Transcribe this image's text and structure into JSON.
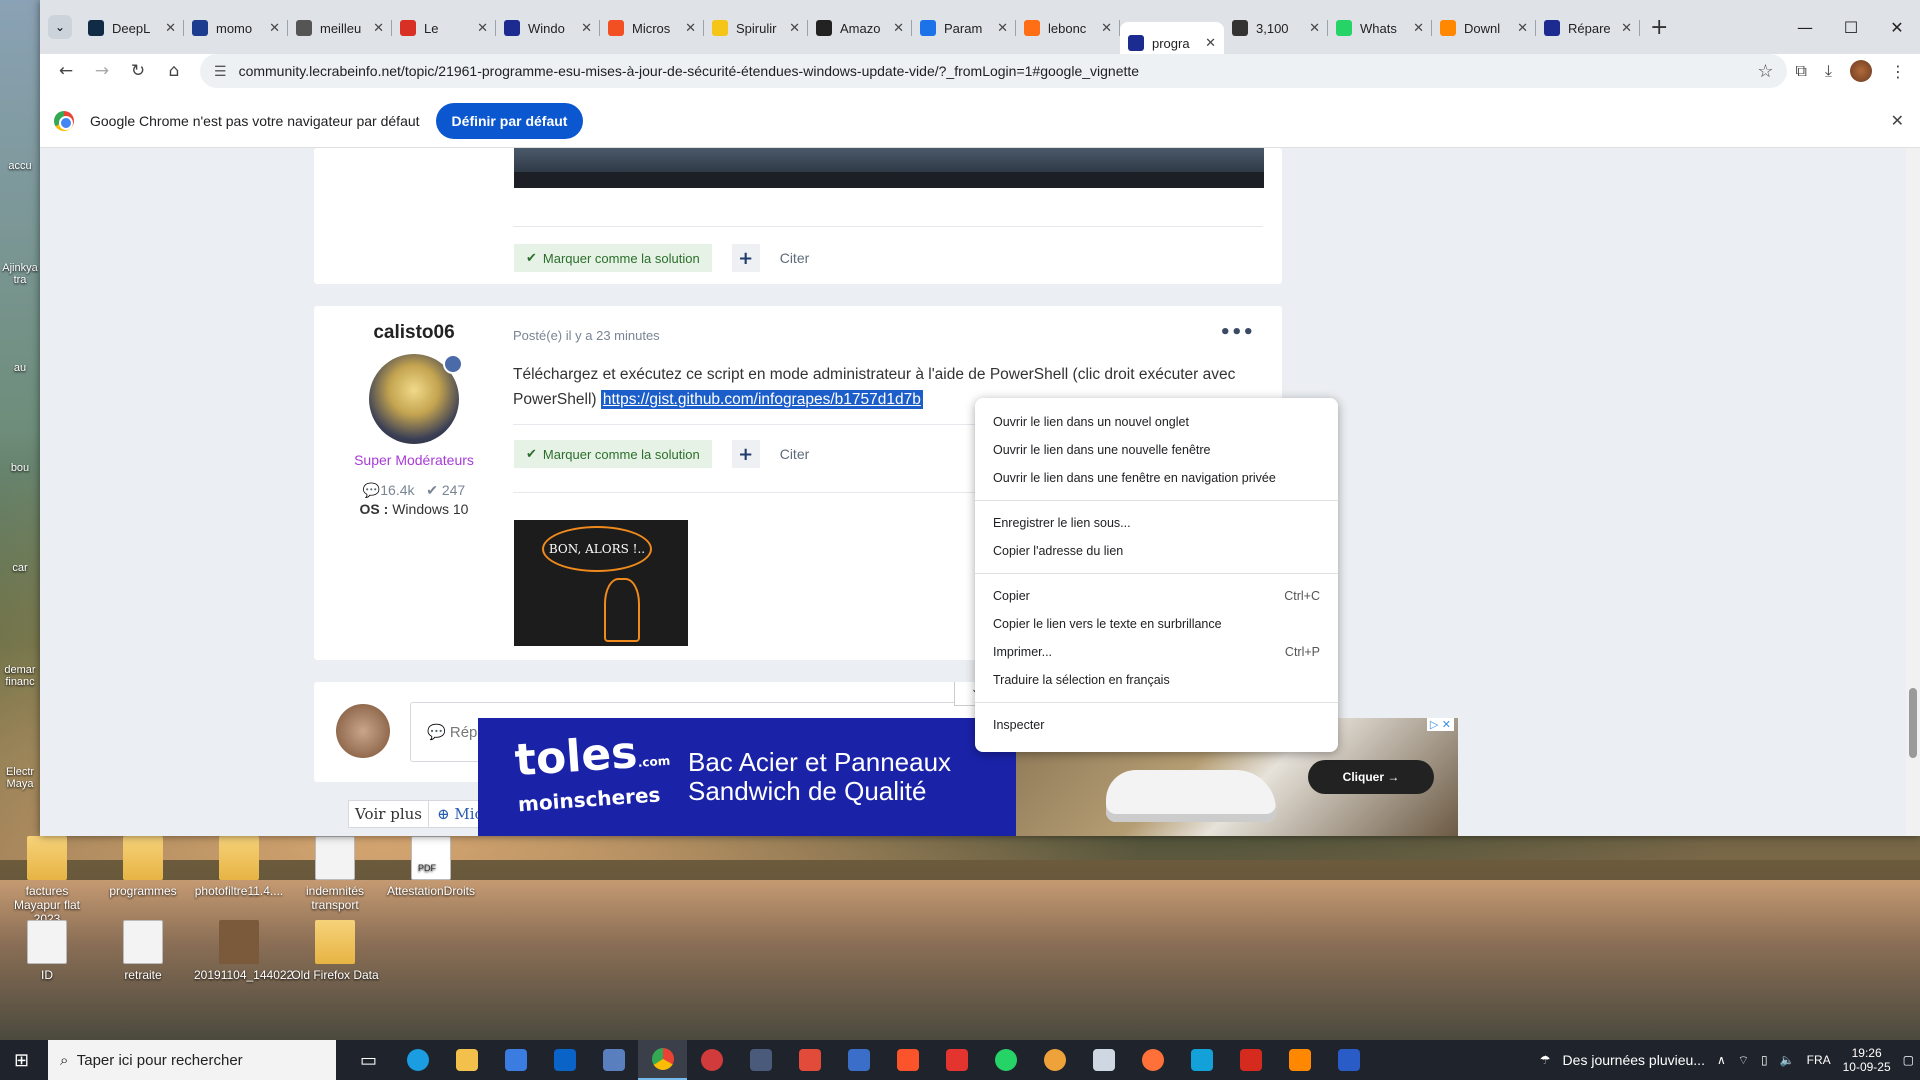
{
  "desktop": {
    "icons": [
      {
        "label": "factures Mayapur flat 2023"
      },
      {
        "label": "programmes"
      },
      {
        "label": "photofiltre11.4...."
      },
      {
        "label": "indemnités transport"
      },
      {
        "label": "AttestationDroits"
      },
      {
        "label": "ID"
      },
      {
        "label": "retraite"
      },
      {
        "label": "20191104_144022"
      },
      {
        "label": "Old Firefox Data"
      }
    ],
    "left_labels": [
      "accu",
      "Ajinkya tra",
      "au",
      "bou",
      "car",
      "demar financ",
      "Electr Maya"
    ]
  },
  "browser": {
    "tabs": [
      {
        "label": "DeepL",
        "fav_color": "#0f2b46"
      },
      {
        "label": "momo",
        "fav_color": "#1b3c8f"
      },
      {
        "label": "meilleu",
        "fav_color": "#555555"
      },
      {
        "label": "Le",
        "fav_color": "#d93025"
      },
      {
        "label": "Windo",
        "fav_color": "#1b2b8f"
      },
      {
        "label": "Micros",
        "fav_color": "#f25022"
      },
      {
        "label": "Spirulir",
        "fav_color": "#f5c518"
      },
      {
        "label": "Amazo",
        "fav_color": "#222222"
      },
      {
        "label": "Param",
        "fav_color": "#1a73e8"
      },
      {
        "label": "lebonc",
        "fav_color": "#ff6e14"
      },
      {
        "label": "progra",
        "fav_color": "#1b2b8f",
        "active": true
      },
      {
        "label": "3,100",
        "fav_color": "#333333"
      },
      {
        "label": "Whats",
        "fav_color": "#25d366"
      },
      {
        "label": "Downl",
        "fav_color": "#ff8800"
      },
      {
        "label": "Répare",
        "fav_color": "#1b2b8f"
      }
    ],
    "url": "community.lecrabeinfo.net/topic/21961-programme-esu-mises-à-jour-de-sécurité-étendues-windows-update-vide/?_fromLogin=1#google_vignette",
    "infobar": {
      "message": "Google Chrome n'est pas votre navigateur par défaut",
      "button": "Définir par défaut"
    }
  },
  "page": {
    "prev_post": {
      "solution_btn": "Marquer comme la solution",
      "quote_btn": "Citer"
    },
    "post": {
      "author": "calisto06",
      "role": "Super Modérateurs",
      "posts_count": "16.4k",
      "solutions_count": "247",
      "os_label": "OS :",
      "os_value": "Windows 10",
      "date": "Posté(e) il y a 23 minutes",
      "text": "Téléchargez et exécutez ce script en mode administrateur à l'aide de PowerShell (clic droit exécuter avec PowerShell)",
      "link": "https://gist.github.com/infograpes/b1757d1d7b",
      "solution_btn": "Marquer comme la solution",
      "quote_btn": "Citer",
      "signature_text": "BON, ALORS !.."
    },
    "reply_placeholder": "Répo",
    "see_more": "Voir plus",
    "mic": "Mic"
  },
  "context_menu": {
    "group1": [
      "Ouvrir le lien dans un nouvel onglet",
      "Ouvrir le lien dans une nouvelle fenêtre",
      "Ouvrir le lien dans une fenêtre en navigation privée"
    ],
    "group2": [
      "Enregistrer le lien sous...",
      "Copier l'adresse du lien"
    ],
    "copy": {
      "label": "Copier",
      "shortcut": "Ctrl+C"
    },
    "copy_highlight": "Copier le lien vers le texte en surbrillance",
    "print": {
      "label": "Imprimer...",
      "shortcut": "Ctrl+P"
    },
    "translate": "Traduire la sélection en français",
    "inspect": "Inspecter"
  },
  "ad": {
    "brand_line1": "toles",
    "brand_line2": "moinscheres",
    "brand_tld": ".com",
    "headline1": "Bac Acier et Panneaux",
    "headline2": "Sandwich de Qualité",
    "cta": "Cliquer →"
  },
  "taskbar": {
    "search_placeholder": "Taper ici pour rechercher",
    "weather": "Des journées pluvieu...",
    "lang": "FRA",
    "time": "19:26",
    "date": "10-09-25"
  }
}
